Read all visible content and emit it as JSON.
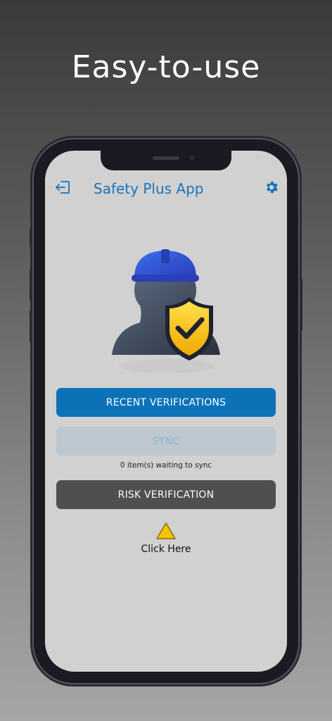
{
  "promo": {
    "headline": "Easy-to-use"
  },
  "header": {
    "title": "Safety Plus App"
  },
  "icons": {
    "logout": "logout-icon",
    "settings": "gear-icon",
    "hero": "worker-shield-icon",
    "warning": "warning-icon"
  },
  "buttons": {
    "recent": "RECENT VERIFICATIONS",
    "sync": "SYNC",
    "risk": "RISK VERIFICATION"
  },
  "sync_status": "0 item(s) waiting to sync",
  "warning_link": "Click Here",
  "colors": {
    "brand_blue": "#0b72b8",
    "title_blue": "#1a73b8",
    "sync_disabled": "#bcc7cf",
    "risk_dark": "#4f4f4f",
    "shield_yellow": "#f5c400",
    "helmet_blue": "#2f5ee8"
  }
}
